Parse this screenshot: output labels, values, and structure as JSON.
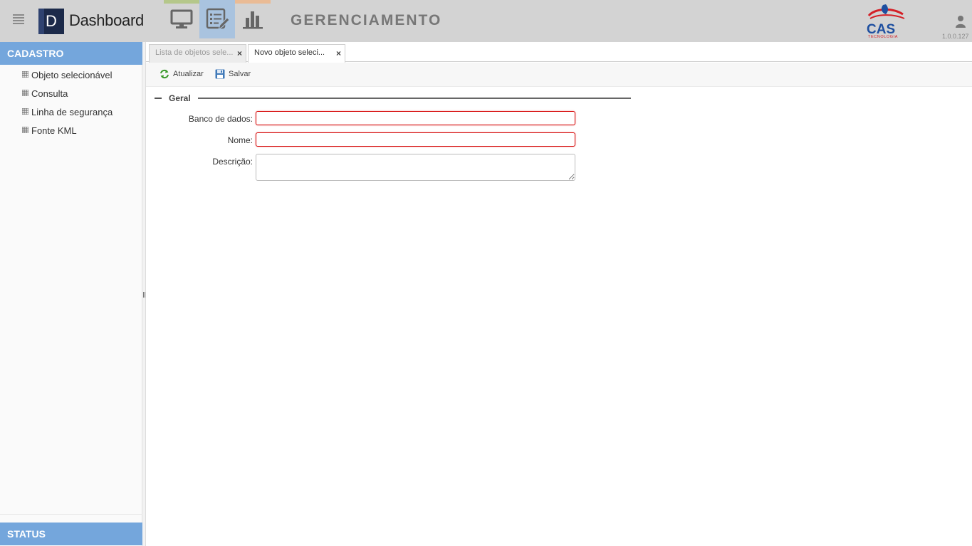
{
  "header": {
    "logo_letter": "D",
    "app_name": "Dashboard",
    "section_title": "GERENCIAMENTO",
    "brand_name": "CAS",
    "brand_tagline": "TECNOLOGIA",
    "version": "1.0.0.127",
    "nav_tabs": [
      {
        "icon": "monitor-icon",
        "accent": "#b5c78a"
      },
      {
        "icon": "edit-list-icon",
        "accent": "#a9c3df",
        "active": true
      },
      {
        "icon": "bar-chart-icon",
        "accent": "#eabb95"
      }
    ]
  },
  "sidebar": {
    "cadastro_title": "CADASTRO",
    "items": [
      {
        "label": "Objeto selecionável",
        "icon": "grid-icon"
      },
      {
        "label": "Consulta",
        "icon": "grid-icon"
      },
      {
        "label": "Linha de segurança",
        "icon": "grid-icon"
      },
      {
        "label": "Fonte KML",
        "icon": "grid-icon"
      }
    ],
    "status_title": "STATUS"
  },
  "tabs": [
    {
      "label": "Lista de objetos sele...",
      "active": false
    },
    {
      "label": "Novo objeto seleci...",
      "active": true
    }
  ],
  "toolbar": {
    "refresh_label": "Atualizar",
    "save_label": "Salvar"
  },
  "form": {
    "legend": "Geral",
    "fields": [
      {
        "label": "Banco de dados:",
        "value": "",
        "required": true
      },
      {
        "label": "Nome:",
        "value": "",
        "required": true
      },
      {
        "label": "Descrição:",
        "value": "",
        "multiline": true
      }
    ]
  },
  "colors": {
    "header_bg": "#d3d3d3",
    "panel_head": "#74a6dc",
    "invalid_border": "#d40000",
    "brand_red": "#d42027",
    "brand_blue": "#1e4fa0"
  }
}
